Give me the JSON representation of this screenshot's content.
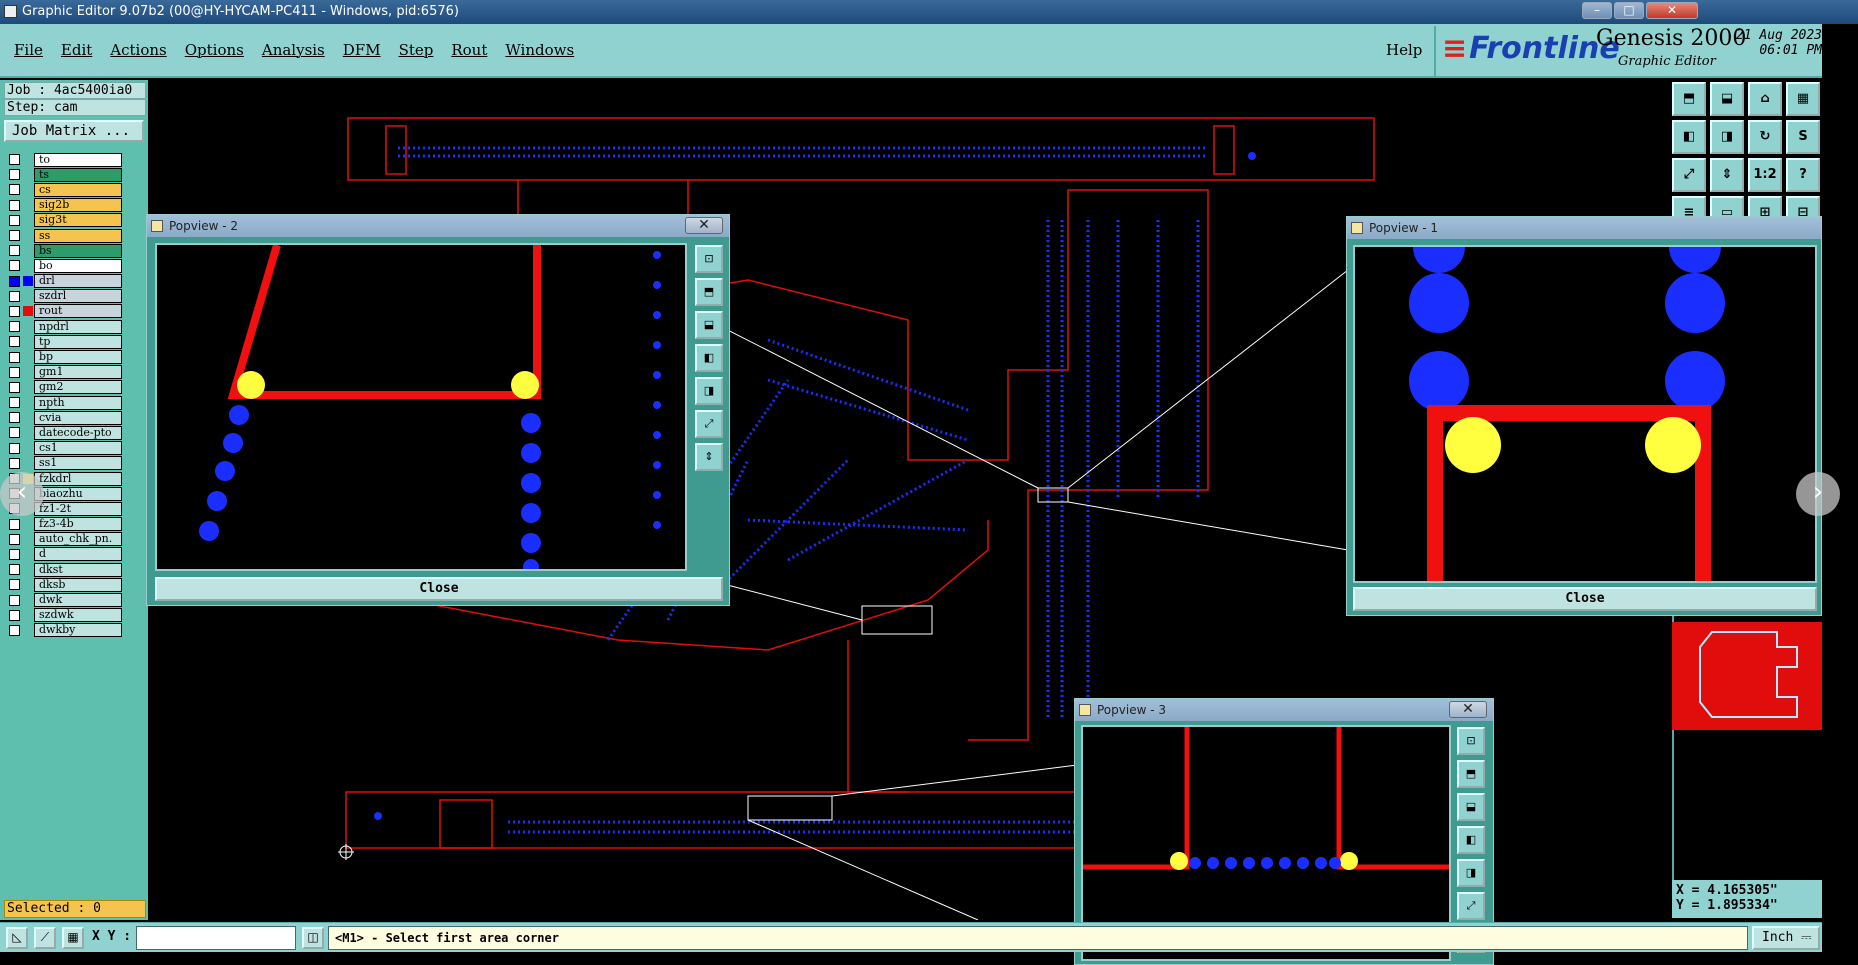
{
  "window": {
    "title": "Graphic Editor 9.07b2 (00@HY-HYCAM-PC411 - Windows, pid:6576)",
    "min_label": "–",
    "max_label": "□",
    "close_label": "✕"
  },
  "menu": {
    "items": [
      "File",
      "Edit",
      "Actions",
      "Options",
      "Analysis",
      "DFM",
      "Step",
      "Rout",
      "Windows"
    ],
    "help": "Help"
  },
  "brand": {
    "logo_lines": "≡",
    "logo": "Frontline",
    "product": "Genesis 2000",
    "subtitle": "Graphic Editor",
    "date": "21 Aug 2023",
    "time": "06:01 PM"
  },
  "left": {
    "job": "Job : 4ac5400ia0",
    "step": "Step: cam",
    "job_matrix": "Job Matrix ...",
    "selected": "Selected : 0",
    "layers": [
      {
        "name": "to",
        "color": "#ffffff",
        "swatch": ""
      },
      {
        "name": "ts",
        "color": "#2e9b6b",
        "swatch": ""
      },
      {
        "name": "cs",
        "color": "#f4c44f",
        "swatch": ""
      },
      {
        "name": "sig2b",
        "color": "#f4c44f",
        "swatch": ""
      },
      {
        "name": "sig3t",
        "color": "#f4c44f",
        "swatch": ""
      },
      {
        "name": "ss",
        "color": "#f4c44f",
        "swatch": ""
      },
      {
        "name": "bs",
        "color": "#2e9b6b",
        "swatch": ""
      },
      {
        "name": "bo",
        "color": "#ffffff",
        "swatch": ""
      },
      {
        "name": "drl",
        "color": "#c8d4dc",
        "swatch": "#0000ff",
        "on": true
      },
      {
        "name": "szdrl",
        "color": "#c8d4dc",
        "swatch": ""
      },
      {
        "name": "rout",
        "color": "#c8d4dc",
        "swatch": "#e10d0d"
      },
      {
        "name": "npdrl",
        "color": "#bfe3e0",
        "swatch": ""
      },
      {
        "name": "tp",
        "color": "#bfe3e0",
        "swatch": ""
      },
      {
        "name": "bp",
        "color": "#bfe3e0",
        "swatch": ""
      },
      {
        "name": "gm1",
        "color": "#bfe3e0",
        "swatch": ""
      },
      {
        "name": "gm2",
        "color": "#bfe3e0",
        "swatch": ""
      },
      {
        "name": "npth",
        "color": "#bfe3e0",
        "swatch": ""
      },
      {
        "name": "cvia",
        "color": "#bfe3e0",
        "swatch": ""
      },
      {
        "name": "datecode-pto",
        "color": "#bfe3e0",
        "swatch": ""
      },
      {
        "name": "cs1",
        "color": "#bfe3e0",
        "swatch": ""
      },
      {
        "name": "ss1",
        "color": "#bfe3e0",
        "swatch": ""
      },
      {
        "name": "fzkdrl",
        "color": "#bfe3e0",
        "swatch": "#ffff60"
      },
      {
        "name": "biaozhu",
        "color": "#bfe3e0",
        "swatch": ""
      },
      {
        "name": "fz1-2t",
        "color": "#bfe3e0",
        "swatch": ""
      },
      {
        "name": "fz3-4b",
        "color": "#bfe3e0",
        "swatch": ""
      },
      {
        "name": "auto_chk_pn.",
        "color": "#bfe3e0",
        "swatch": ""
      },
      {
        "name": "d",
        "color": "#bfe3e0",
        "swatch": ""
      },
      {
        "name": "dkst",
        "color": "#bfe3e0",
        "swatch": ""
      },
      {
        "name": "dksb",
        "color": "#bfe3e0",
        "swatch": ""
      },
      {
        "name": "dwk",
        "color": "#bfe3e0",
        "swatch": ""
      },
      {
        "name": "szdwk",
        "color": "#bfe3e0",
        "swatch": ""
      },
      {
        "name": "dwkby",
        "color": "#bfe3e0",
        "swatch": ""
      }
    ]
  },
  "tools": [
    "⬒",
    "⬓",
    "⌂",
    "▦",
    "◧",
    "◨",
    "↻",
    "S",
    "⤢",
    "⇕",
    "1:2",
    "?",
    "≡",
    "▭",
    "⊞",
    "⊟"
  ],
  "popviews": [
    {
      "title": "Popview - 2",
      "close": "Close",
      "x_label": "✕"
    },
    {
      "title": "Popview - 1",
      "close": "Close",
      "x_label": "✕"
    },
    {
      "title": "Popview - 3",
      "x_label": "✕"
    }
  ],
  "pv_tools": [
    "⊡",
    "⬒",
    "⬓",
    "◧",
    "◨",
    "⤢",
    "⇕"
  ],
  "status": {
    "xy_label": "X Y :",
    "xy_value": "",
    "prompt": "<M1> - Select first area corner",
    "unit": "Inch ⎓",
    "x": "X = 4.165305\"",
    "y": "Y = 1.895334\""
  },
  "nav": {
    "prev": "‹",
    "next": "›"
  },
  "colors": {
    "panel": "#8fd2cf",
    "rout": "#e10d0d",
    "drill": "#0000ff",
    "pad": "#ffff40"
  }
}
